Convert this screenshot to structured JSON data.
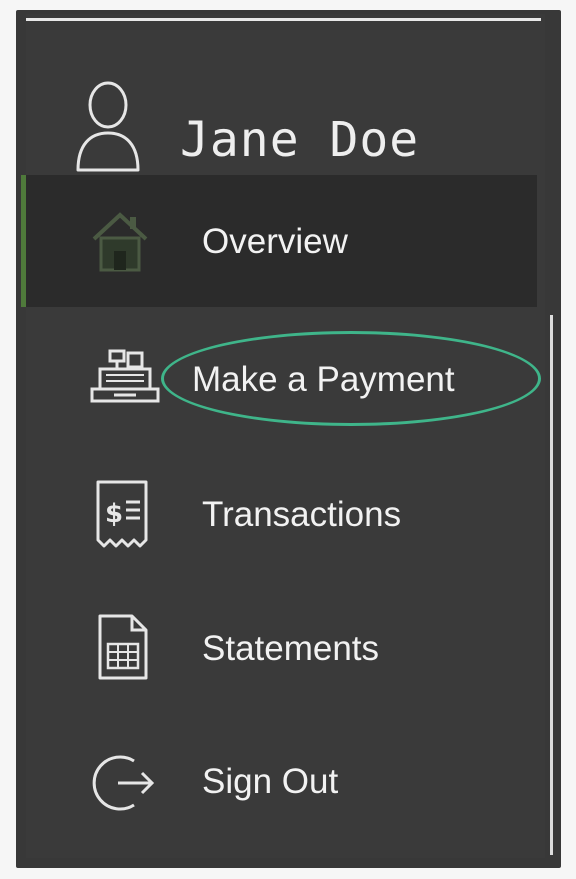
{
  "user": {
    "name": "Jane Doe",
    "icon": "user-avatar-icon"
  },
  "nav": {
    "items": [
      {
        "label": "Overview",
        "icon": "house-icon",
        "active": true
      },
      {
        "label": "Make a Payment",
        "icon": "cash-register-icon",
        "active": false
      },
      {
        "label": "Transactions",
        "icon": "receipt-icon",
        "active": false
      },
      {
        "label": "Statements",
        "icon": "spreadsheet-icon",
        "active": false
      },
      {
        "label": "Sign Out",
        "icon": "sign-out-icon",
        "active": false
      }
    ]
  },
  "colors": {
    "panel": "#383838",
    "active_background": "#2b2b2b",
    "active_indicator": "#4f7a3b",
    "highlight_ring": "#3fb58a",
    "text": "#f2f2f2"
  }
}
